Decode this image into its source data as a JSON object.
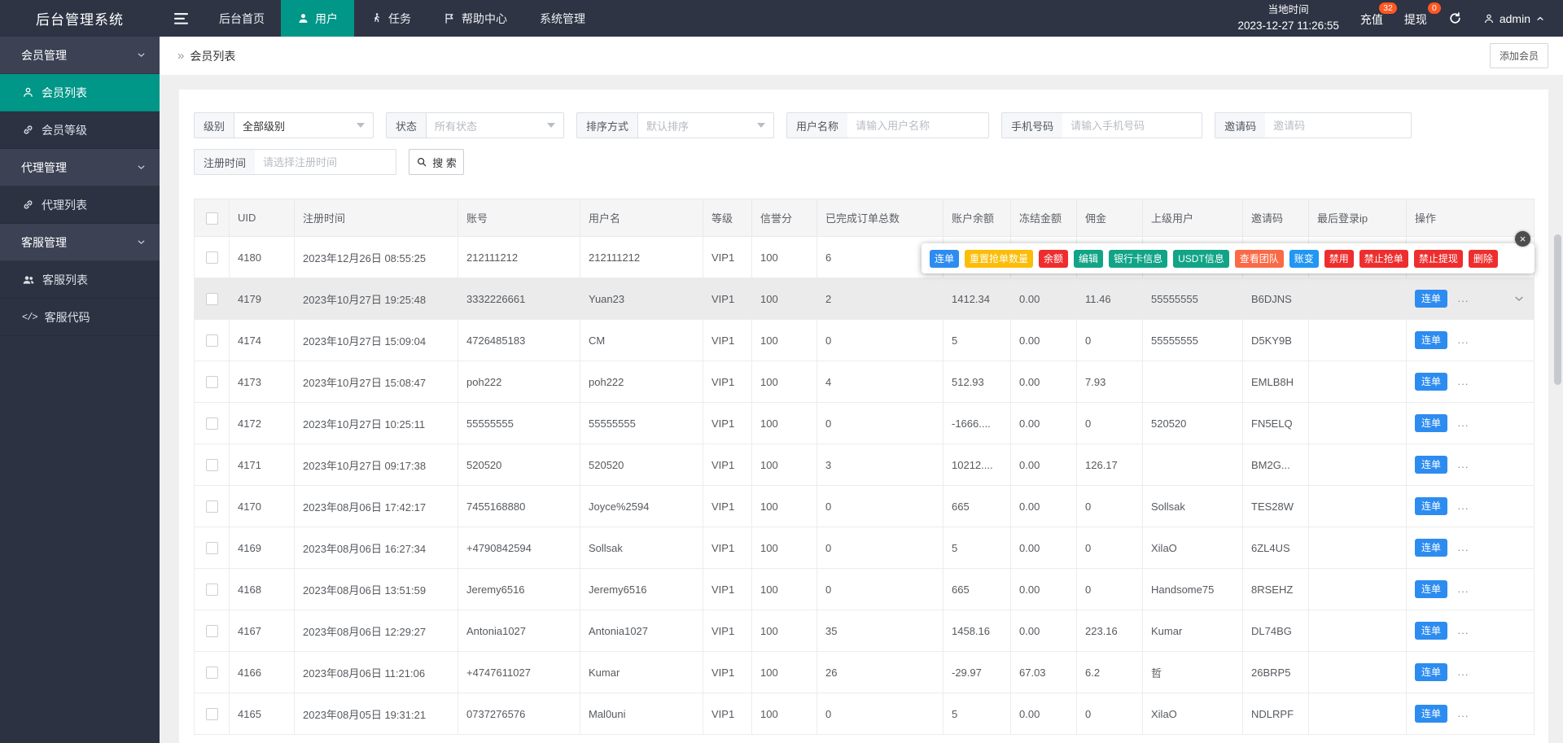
{
  "colors": {
    "accent": "#009688",
    "badge": "#ff5722",
    "primary_button": "#2d8cf0"
  },
  "topbar": {
    "brand": "后台管理系统",
    "menu": {
      "home": "后台首页",
      "user": "用户",
      "task": "任务",
      "help": "帮助中心",
      "system": "系统管理"
    },
    "local_time_label": "当地时间",
    "local_time": "2023-12-27 11:26:55",
    "recharge_label": "充值",
    "recharge_badge": "32",
    "withdraw_label": "提现",
    "withdraw_badge": "0",
    "username": "admin"
  },
  "sidebar": {
    "groups": [
      {
        "label": "会员管理",
        "items": [
          {
            "label": "会员列表"
          },
          {
            "label": "会员等级"
          }
        ]
      },
      {
        "label": "代理管理",
        "items": [
          {
            "label": "代理列表"
          }
        ]
      },
      {
        "label": "客服管理",
        "items": [
          {
            "label": "客服列表"
          },
          {
            "label": "客服代码"
          }
        ]
      }
    ]
  },
  "page": {
    "breadcrumb_icon": "»",
    "breadcrumb": "会员列表",
    "add_button": "添加会员"
  },
  "filters": {
    "level_label": "级别",
    "level_value": "全部级别",
    "status_label": "状态",
    "status_value": "所有状态",
    "sort_label": "排序方式",
    "sort_value": "默认排序",
    "username_label": "用户名称",
    "username_placeholder": "请输入用户名称",
    "phone_label": "手机号码",
    "phone_placeholder": "请输入手机号码",
    "invite_label": "邀请码",
    "invite_placeholder": "邀请码",
    "regtime_label": "注册时间",
    "regtime_placeholder": "请选择注册时间",
    "search_label": "搜 索"
  },
  "table": {
    "columns": [
      "UID",
      "注册时间",
      "账号",
      "用户名",
      "等级",
      "信誉分",
      "已完成订单总数",
      "账户余额",
      "冻结金额",
      "佣金",
      "上级用户",
      "邀请码",
      "最后登录ip",
      "操作"
    ],
    "action_label": "连单",
    "more_label": "...",
    "rows": [
      {
        "uid": "4180",
        "reg_time": "2023年12月26日 08:55:25",
        "account": "212111212",
        "username": "212111212",
        "level": "VIP1",
        "credit": "100",
        "orders": "6",
        "balance": "",
        "frozen": "",
        "commission": "",
        "parent": "",
        "invite": "",
        "last_ip": "",
        "show_action": false,
        "highlighted": false,
        "expand": false
      },
      {
        "uid": "4179",
        "reg_time": "2023年10月27日 19:25:48",
        "account": "3332226661",
        "username": "Yuan23",
        "level": "VIP1",
        "credit": "100",
        "orders": "2",
        "balance": "1412.34",
        "frozen": "0.00",
        "commission": "11.46",
        "parent": "55555555",
        "invite": "B6DJNS",
        "last_ip": "",
        "show_action": true,
        "highlighted": true,
        "expand": true
      },
      {
        "uid": "4174",
        "reg_time": "2023年10月27日 15:09:04",
        "account": "4726485183",
        "username": "CM",
        "level": "VIP1",
        "credit": "100",
        "orders": "0",
        "balance": "5",
        "frozen": "0.00",
        "commission": "0",
        "parent": "55555555",
        "invite": "D5KY9B",
        "last_ip": "",
        "show_action": true,
        "highlighted": false,
        "expand": false
      },
      {
        "uid": "4173",
        "reg_time": "2023年10月27日 15:08:47",
        "account": "poh222",
        "username": "poh222",
        "level": "VIP1",
        "credit": "100",
        "orders": "4",
        "balance": "512.93",
        "frozen": "0.00",
        "commission": "7.93",
        "parent": "",
        "invite": "EMLB8H",
        "last_ip": "",
        "show_action": true,
        "highlighted": false,
        "expand": false
      },
      {
        "uid": "4172",
        "reg_time": "2023年10月27日 10:25:11",
        "account": "55555555",
        "username": "55555555",
        "level": "VIP1",
        "credit": "100",
        "orders": "0",
        "balance": "-1666....",
        "frozen": "0.00",
        "commission": "0",
        "parent": "520520",
        "invite": "FN5ELQ",
        "last_ip": "",
        "show_action": true,
        "highlighted": false,
        "expand": false
      },
      {
        "uid": "4171",
        "reg_time": "2023年10月27日 09:17:38",
        "account": "520520",
        "username": "520520",
        "level": "VIP1",
        "credit": "100",
        "orders": "3",
        "balance": "10212....",
        "frozen": "0.00",
        "commission": "126.17",
        "parent": "",
        "invite": "BM2G...",
        "last_ip": "",
        "show_action": true,
        "highlighted": false,
        "expand": false
      },
      {
        "uid": "4170",
        "reg_time": "2023年08月06日 17:42:17",
        "account": "7455168880",
        "username": "Joyce%2594",
        "level": "VIP1",
        "credit": "100",
        "orders": "0",
        "balance": "665",
        "frozen": "0.00",
        "commission": "0",
        "parent": "Sollsak",
        "invite": "TES28W",
        "last_ip": "",
        "show_action": true,
        "highlighted": false,
        "expand": false
      },
      {
        "uid": "4169",
        "reg_time": "2023年08月06日 16:27:34",
        "account": "+4790842594",
        "username": "Sollsak",
        "level": "VIP1",
        "credit": "100",
        "orders": "0",
        "balance": "5",
        "frozen": "0.00",
        "commission": "0",
        "parent": "XilaO",
        "invite": "6ZL4US",
        "last_ip": "",
        "show_action": true,
        "highlighted": false,
        "expand": false
      },
      {
        "uid": "4168",
        "reg_time": "2023年08月06日 13:51:59",
        "account": "Jeremy6516",
        "username": "Jeremy6516",
        "level": "VIP1",
        "credit": "100",
        "orders": "0",
        "balance": "665",
        "frozen": "0.00",
        "commission": "0",
        "parent": "Handsome75",
        "invite": "8RSEHZ",
        "last_ip": "",
        "show_action": true,
        "highlighted": false,
        "expand": false
      },
      {
        "uid": "4167",
        "reg_time": "2023年08月06日 12:29:27",
        "account": "Antonia1027",
        "username": "Antonia1027",
        "level": "VIP1",
        "credit": "100",
        "orders": "35",
        "balance": "1458.16",
        "frozen": "0.00",
        "commission": "223.16",
        "parent": "Kumar",
        "invite": "DL74BG",
        "last_ip": "",
        "show_action": true,
        "highlighted": false,
        "expand": false
      },
      {
        "uid": "4166",
        "reg_time": "2023年08月06日 11:21:06",
        "account": "+4747611027",
        "username": "Kumar",
        "level": "VIP1",
        "credit": "100",
        "orders": "26",
        "balance": "-29.97",
        "frozen": "67.03",
        "commission": "6.2",
        "parent": "哲",
        "invite": "26BRP5",
        "last_ip": "",
        "show_action": true,
        "highlighted": false,
        "expand": false
      },
      {
        "uid": "4165",
        "reg_time": "2023年08月05日 19:31:21",
        "account": "0737276576",
        "username": "Mal0uni",
        "level": "VIP1",
        "credit": "100",
        "orders": "0",
        "balance": "5",
        "frozen": "0.00",
        "commission": "0",
        "parent": "XilaO",
        "invite": "NDLRPF",
        "last_ip": "",
        "show_action": true,
        "highlighted": false,
        "expand": false
      }
    ]
  },
  "popup": {
    "close": "×",
    "buttons": [
      {
        "label": "连单",
        "color": "#2d8cf0"
      },
      {
        "label": "重置抢单数量",
        "color": "#fbbd08"
      },
      {
        "label": "余额",
        "color": "#ee2e2e"
      },
      {
        "label": "编辑",
        "color": "#11a487"
      },
      {
        "label": "银行卡信息",
        "color": "#11a487"
      },
      {
        "label": "USDT信息",
        "color": "#11a487"
      },
      {
        "label": "查看团队",
        "color": "#fa6a47"
      },
      {
        "label": "账变",
        "color": "#2196f3"
      },
      {
        "label": "禁用",
        "color": "#ee2e2e"
      },
      {
        "label": "禁止抢单",
        "color": "#ee2e2e"
      },
      {
        "label": "禁止提现",
        "color": "#ee2e2e"
      },
      {
        "label": "删除",
        "color": "#ee2e2e"
      }
    ]
  }
}
